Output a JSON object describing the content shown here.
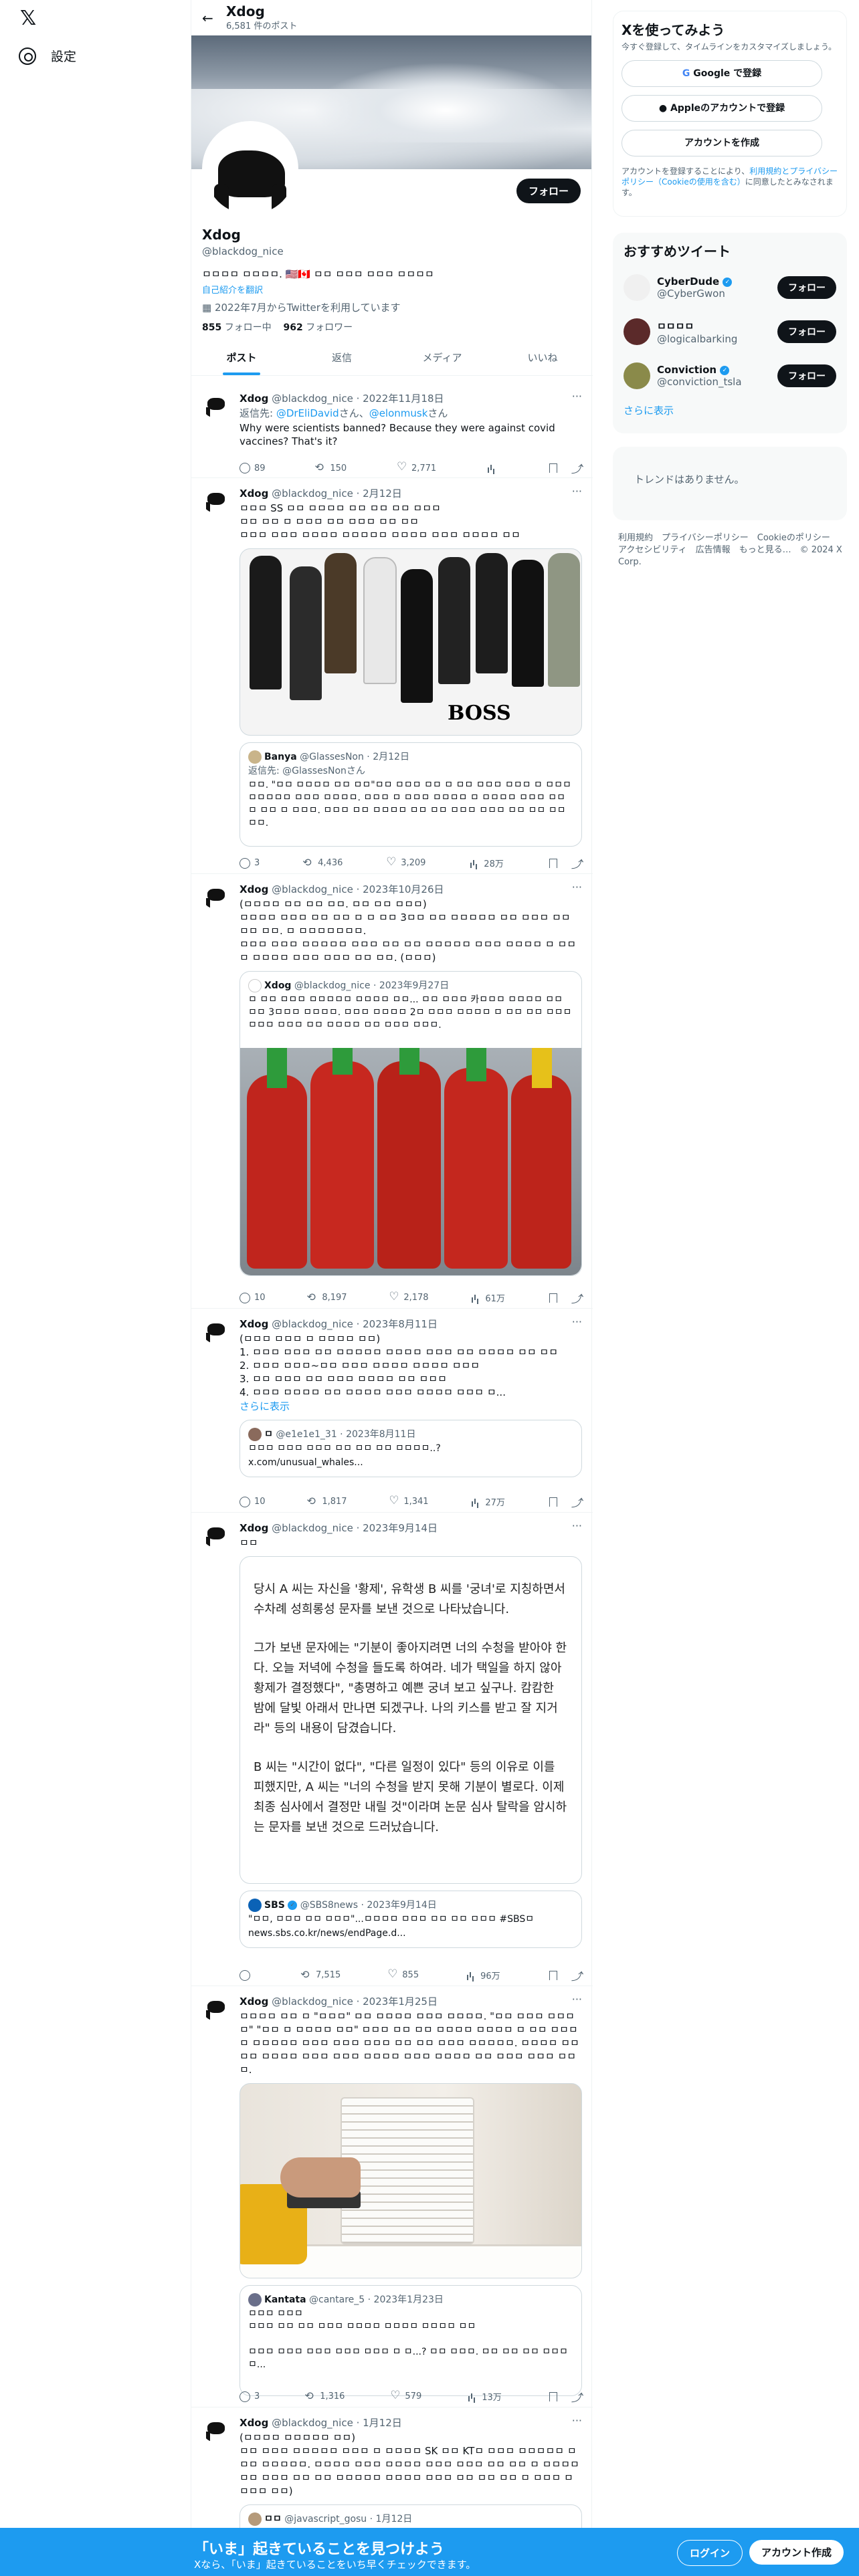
{
  "nav": {
    "settings": "設定"
  },
  "header": {
    "name": "Xdog",
    "posts_count": "6,581 件のポスト"
  },
  "profile": {
    "follow": "フォロー",
    "name": "Xdog",
    "handle": "@blackdog_nice",
    "bio": "ㅁㅁㅁㅁ ㅁㅁㅁㅁ. 🇺🇸🇨🇦 ㅁㅁ ㅁㅁㅁ ㅁㅁㅁ ㅁㅁㅁㅁ",
    "translate": "自己紹介を翻訳",
    "joined": "2022年7月からTwitterを利用しています",
    "following_num": "855",
    "following_label": "フォロー中",
    "followers_num": "962",
    "followers_label": "フォロワー"
  },
  "tabs": [
    "ポスト",
    "返信",
    "メディア",
    "いいね"
  ],
  "tweets": [
    {
      "name": "Xdog",
      "handle": "@blackdog_nice",
      "date": "2022年11月18日",
      "reply_to": "返信先:",
      "reply1": "@DrEliDavid",
      "san1": "さん、",
      "reply2": "@elonmusk",
      "san2": "さん",
      "text": "Why were scientists banned? Because they were against covid vaccines? That's it?",
      "replies": "89",
      "retweets": "150",
      "likes": "2,771",
      "views": ""
    },
    {
      "name": "Xdog",
      "handle": "@blackdog_nice",
      "date": "2月12日",
      "text": "ㅁㅁㅁ SS ㅁㅁ ㅁㅁㅁㅁ ㅁㅁ ㅁㅁ ㅁㅁ ㅁㅁㅁ\nㅁㅁ ㅁㅁ ㅁ ㅁㅁㅁ ㅁㅁ ㅁㅁㅁ ㅁㅁ ㅁㅁ\nㅁㅁㅁ ㅁㅁㅁ ㅁㅁㅁㅁ ㅁㅁㅁㅁㅁ ㅁㅁㅁㅁ ㅁㅁㅁ ㅁㅁㅁㅁ ㅁㅁ",
      "image_caption": "BOSS",
      "quote": {
        "name": "Banya",
        "handle": "@GlassesNon",
        "date": "2月12日",
        "reply_line": "返信先: @GlassesNonさん",
        "text": "ㅁㅁ. \"ㅁㅁ ㅁㅁㅁㅁ ㅁㅁ ㅁㅁ\"ㅁㅁ ㅁㅁㅁ ㅁㅁ ㅁ ㅁㅁ ㅁㅁㅁ ㅁㅁㅁ ㅁ ㅁㅁㅁ ㅁㅁㅁㅁㅁ ㅁㅁㅁ ㅁㅁㅁㅁ. ㅁㅁㅁ ㅁ ㅁㅁㅁ ㅁㅁㅁㅁ ㅁ ㅁㅁㅁㅁ ㅁㅁㅁ ㅁㅁㅁ ㅁㅁ ㅁ ㅁㅁㅁ. ㅁㅁㅁ ㅁㅁ ㅁㅁㅁㅁ ㅁㅁ ㅁㅁ ㅁㅁㅁ ㅁㅁㅁ ㅁㅁ ㅁㅁ ㅁㅁ ㅁㅁ."
      },
      "replies": "3",
      "retweets": "4,436",
      "likes": "3,209",
      "views": "28万"
    },
    {
      "name": "Xdog",
      "handle": "@blackdog_nice",
      "date": "2023年10月26日",
      "text": "(ㅁㅁㅁㅁ ㅁㅁ ㅁㅁ ㅁㅁ. ㅁㅁ ㅁㅁ ㅁㅁㅁ)\nㅁㅁㅁㅁ ㅁㅁㅁ ㅁㅁ ㅁㅁ ㅁ ㅁ ㅁㅁ 3ㅁㅁ ㅁㅁ ㅁㅁㅁㅁㅁ ㅁㅁ ㅁㅁㅁ ㅁㅁ ㅁㅁ ㅁㅁ. ㅁ ㅁㅁㅁㅁㅁㅁㅁ.\nㅁㅁㅁ ㅁㅁㅁ ㅁㅁㅁㅁㅁ ㅁㅁㅁ ㅁㅁ ㅁㅁ ㅁㅁㅁㅁㅁ ㅁㅁㅁ ㅁㅁㅁㅁ ㅁ ㅁㅁㅁ ㅁㅁㅁㅁ ㅁㅁㅁ ㅁㅁㅁ ㅁㅁ ㅁㅁ. (ㅁㅁㅁ)",
      "quote": {
        "name": "Xdog",
        "handle": "@blackdog_nice",
        "date": "2023年9月27日",
        "text": "ㅁ ㅁㅁ ㅁㅁㅁ ㅁㅁㅁㅁㅁ ㅁㅁㅁㅁ ㅁㅁ... ㅁㅁ ㅁㅁㅁ 카ㅁㅁㅁ ㅁㅁㅁㅁ ㅁㅁ ㅁㅁ 3ㅁㅁㅁ ㅁㅁㅁㅁ. ㅁㅁㅁ ㅁㅁㅁㅁ 2ㅁ ㅁㅁㅁ ㅁㅁㅁㅁ ㅁ ㅁㅁ ㅁㅁ ㅁㅁㅁ ㅁㅁㅁ ㅁㅁㅁ ㅁㅁ ㅁㅁㅁㅁ ㅁㅁ ㅁㅁㅁ ㅁㅁㅁ."
      },
      "replies": "10",
      "retweets": "8,197",
      "likes": "2,178",
      "views": "61万"
    },
    {
      "name": "Xdog",
      "handle": "@blackdog_nice",
      "date": "2023年8月11日",
      "text": "(ㅁㅁㅁ ㅁㅁㅁ ㅁ ㅁㅁㅁㅁ ㅁㅁ)\n1. ㅁㅁㅁ ㅁㅁㅁ ㅁㅁ ㅁㅁㅁㅁㅁ ㅁㅁㅁㅁ ㅁㅁㅁ ㅁㅁ ㅁㅁㅁㅁ ㅁㅁ ㅁㅁ\n2. ㅁㅁㅁ ㅁㅁㅁ~ㅁㅁ ㅁㅁㅁ ㅁㅁㅁㅁ ㅁㅁㅁㅁ ㅁㅁㅁ\n3. ㅁㅁ ㅁㅁㅁ ㅁㅁ ㅁㅁㅁ ㅁㅁㅁㅁ ㅁㅁ ㅁㅁㅁ\n4. ㅁㅁㅁ ㅁㅁㅁㅁ ㅁㅁ ㅁㅁㅁㅁ ㅁㅁㅁ ㅁㅁㅁㅁ ㅁㅁㅁ ㅁ...",
      "more": "さらに表示",
      "quote": {
        "name": "ㅁ",
        "handle": "@e1e1e1_31",
        "date": "2023年8月11日",
        "text": "ㅁㅁㅁ ㅁㅁㅁ ㅁㅁㅁ ㅁㅁ ㅁㅁ ㅁㅁ ㅁㅁㅁㅁ..?",
        "link": "x.com/unusual_whales..."
      },
      "replies": "10",
      "retweets": "1,817",
      "likes": "1,341",
      "views": "27万"
    },
    {
      "name": "Xdog",
      "handle": "@blackdog_nice",
      "date": "2023年9月14日",
      "text": "ㅁㅁ",
      "image_paragraphs": [
        "당시 A 씨는 자신을 '황제', 유학생 B 씨를 '궁녀'로 지칭하면서 수차례 성희롱성 문자를 보낸 것으로 나타났습니다.",
        "그가 보낸 문자에는 \"기분이 좋아지려면 너의 수청을 받아야 한다. 오늘 저녁에 수청을 들도록 하여라. 네가 택일을 하지 않아 황제가 결정했다\", \"총명하고 예쁜 궁녀 보고 싶구나. 캄캄한 밤에 달빛 아래서 만나면 되겠구나. 나의 키스를 받고 잘 지거라\" 등의 내용이 담겼습니다.",
        "B 씨는 \"시간이 없다\", \"다른 일정이 있다\" 등의 이유로 이를 피했지만, A 씨는 \"너의 수청을 받지 못해 기분이 별로다. 이제 최종 심사에서 결정만 내릴 것\"이라며 논문 심사 탈락을 암시하는 문자를 보낸 것으로 드러났습니다."
      ],
      "quote": {
        "name": "SBS",
        "handle": "@SBS8news",
        "date": "2023年9月14日",
        "text": "\"ㅁㅁ, ㅁㅁㅁ ㅁㅁ ㅁㅁㅁ\"...ㅁㅁㅁㅁ ㅁㅁㅁ ㅁㅁ ㅁㅁ ㅁㅁㅁ #SBSㅁ",
        "link": "news.sbs.co.kr/news/endPage.d..."
      },
      "replies": "",
      "retweets": "7,515",
      "likes": "855",
      "views": "96万"
    },
    {
      "name": "Xdog",
      "handle": "@blackdog_nice",
      "date": "2023年1月25日",
      "text": "ㅁㅁㅁㅁ ㅁㅁ ㅁ \"ㅁㅁㅁ\" ㅁㅁ ㅁㅁㅁㅁ ㅁㅁㅁ ㅁㅁㅁㅁ. \"ㅁㅁ ㅁㅁㅁ ㅁㅁㅁㅁ\" \"ㅁㅁ ㅁ ㅁㅁㅁㅁ ㅁㅁ\" ㅁㅁㅁ ㅁㅁ ㅁㅁ ㅁㅁㅁㅁ ㅁㅁㅁㅁ ㅁ ㅁㅁ ㅁㅁㅁㅁ ㅁㅁㅁㅁㅁ ㅁㅁㅁ ㅁㅁㅁ ㅁㅁㅁ ㅁㅁ ㅁㅁ ㅁㅁㅁ ㅁㅁㅁㅁㅁ. ㅁㅁㅁㅁ ㅁㅁㅁㅁ ㅁㅁㅁㅁ ㅁㅁㅁ ㅁㅁㅁ ㅁㅁㅁㅁ ㅁㅁㅁ ㅁㅁㅁㅁ ㅁㅁ ㅁㅁㅁ ㅁㅁㅁ ㅁㅁㅁ.",
      "quote": {
        "name": "Kantata",
        "handle": "@cantare_5",
        "date": "2023年1月23日",
        "text": "ㅁㅁㅁ ㅁㅁㅁ\nㅁㅁㅁ ㅁㅁ ㅁㅁ ㅁㅁㅁ ㅁㅁㅁㅁ ㅁㅁㅁㅁ ㅁㅁㅁㅁ ㅁㅁ\n\nㅁㅁㅁ ㅁㅁㅁ ㅁㅁㅁ ㅁㅁㅁ ㅁㅁㅁ ㅁ ㅁ...? ㅁㅁ ㅁㅁㅁ. ㅁㅁ ㅁㅁ ㅁㅁ ㅁㅁㅁㅁ..."
      },
      "replies": "3",
      "retweets": "1,316",
      "likes": "579",
      "views": "13万"
    },
    {
      "name": "Xdog",
      "handle": "@blackdog_nice",
      "date": "1月12日",
      "text": "(ㅁㅁㅁㅁ ㅁㅁㅁㅁㅁ ㅁㅁ)\nㅁㅁ ㅁㅁㅁ ㅁㅁㅁㅁㅁ ㅁㅁㅁ ㅁ ㅁㅁㅁㅁ SK ㅁㅁ KTㅁ ㅁㅁㅁ ㅁㅁㅁㅁㅁ ㅁㅁㅁ ㅁㅁㅁㅁㅁ. ㅁㅁㅁㅁ ㅁㅁㅁ ㅁㅁㅁㅁ ㅁㅁㅁ ㅁㅁㅁ ㅁㅁ ㅁㅁ ㅁ ㅁㅁㅁㅁ ㅁㅁ ㅁㅁㅁ ㅁㅁ ㅁㅁ ㅁㅁㅁㅁㅁ ㅁㅁㅁㅁ ㅁㅁㅁ ㅁㅁ ㅁㅁ ㅁㅁ ㅁ ㅁㅁㅁ ㅁㅁㅁㅁ ㅁㅁ)",
      "quote": {
        "name": "ㅁㅁ",
        "handle": "@javascript_gosu",
        "date": "1月12日"
      }
    }
  ],
  "signup": {
    "title": "Xを使ってみよう",
    "subtitle": "今すぐ登録して、タイムラインをカスタマイズしましょう。",
    "google": "Google で登録",
    "apple": "Appleのアカウントで登録",
    "create": "アカウントを作成",
    "terms_pre": "アカウントを登録することにより、",
    "terms_link": "利用規約とプライバシーポリシー（Cookieの使用を含む）",
    "terms_post": "に同意したとみなされます。"
  },
  "recommended": {
    "title": "おすすめツイート",
    "users": [
      {
        "name": "CyberDude",
        "handle": "@CyberGwon",
        "button": "フォロー"
      },
      {
        "name": "ㅁㅁㅁㅁ",
        "handle": "@logicalbarking",
        "button": "フォロー"
      },
      {
        "name": "Conviction",
        "handle": "@conviction_tsla",
        "button": "フォロー"
      }
    ],
    "more": "さらに表示"
  },
  "trends": {
    "empty": "トレンドはありません。"
  },
  "footer": {
    "links": "利用規約　プライバシーポリシー　Cookieのポリシー　アクセシビリティ　広告情報　もっと見る…　© 2024 X Corp."
  },
  "bottom_bar": {
    "title": "「いま」起きていることを見つけよう",
    "subtitle": "Xなら、「いま」起きていることをいち早くチェックできます。",
    "login": "ログイン",
    "signup": "アカウント作成"
  },
  "colors": {
    "accent": "#1d9bf0",
    "text": "#0f1419",
    "muted": "#536471"
  }
}
